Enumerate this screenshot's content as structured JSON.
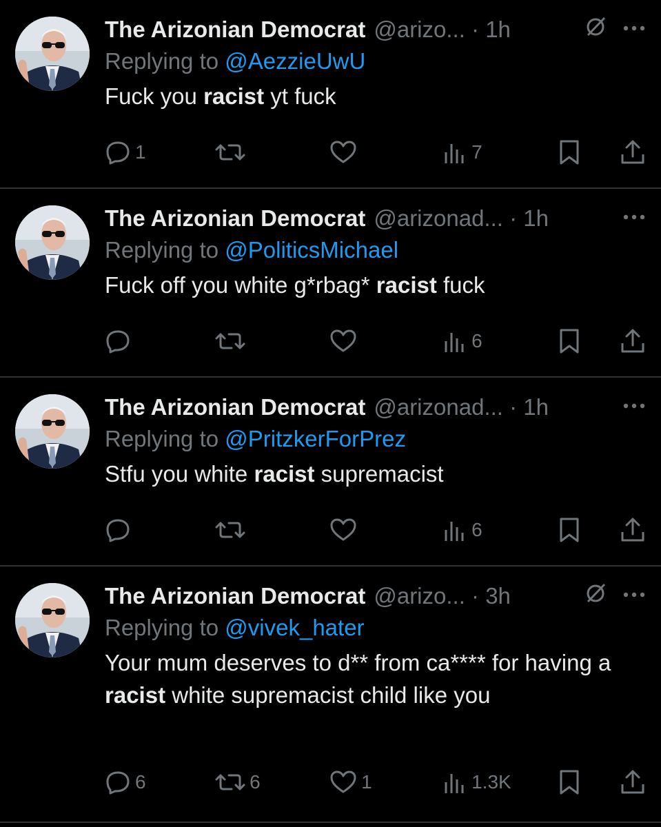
{
  "tweets": [
    {
      "name": "The Arizonian Democrat",
      "handle": "@arizo... · 1h",
      "replying_label": "Replying to",
      "replying_to": "@AezzieUwU",
      "body": [
        {
          "t": "Fuck you "
        },
        {
          "t": "racist",
          "b": true
        },
        {
          "t": " yt fuck"
        }
      ],
      "reply_count": "1",
      "retweet_count": "",
      "like_count": "",
      "view_count": "7",
      "muted_icon": true
    },
    {
      "name": "The Arizonian Democrat",
      "handle": "@arizonad... · 1h",
      "replying_label": "Replying to",
      "replying_to": "@PoliticsMichael",
      "body": [
        {
          "t": "Fuck off you white g*rbag* "
        },
        {
          "t": "racist",
          "b": true
        },
        {
          "t": " fuck"
        }
      ],
      "reply_count": "",
      "retweet_count": "",
      "like_count": "",
      "view_count": "6",
      "muted_icon": false
    },
    {
      "name": "The Arizonian Democrat",
      "handle": "@arizonad... · 1h",
      "replying_label": "Replying to",
      "replying_to": "@PritzkerForPrez",
      "body": [
        {
          "t": "Stfu you white "
        },
        {
          "t": "racist",
          "b": true
        },
        {
          "t": " supremacist"
        }
      ],
      "reply_count": "",
      "retweet_count": "",
      "like_count": "",
      "view_count": "6",
      "muted_icon": false
    },
    {
      "name": "The Arizonian Democrat",
      "handle": "@arizo... · 3h",
      "replying_label": "Replying to",
      "replying_to": "@vivek_hater",
      "body": [
        {
          "t": "Your mum deserves to d** from ca**** for having a "
        },
        {
          "t": "racist",
          "b": true
        },
        {
          "t": " white supremacist child like you"
        }
      ],
      "reply_count": "6",
      "retweet_count": "6",
      "like_count": "1",
      "view_count": "1.3K",
      "muted_icon": true
    }
  ],
  "colors": {
    "background": "#000000",
    "text": "#e7e9ea",
    "secondary": "#71767b",
    "link": "#1d9bf0",
    "divider": "#2f3336"
  },
  "icons": [
    "muted-icon",
    "more-icon",
    "reply-icon",
    "retweet-icon",
    "like-icon",
    "views-icon",
    "bookmark-icon",
    "share-icon"
  ]
}
